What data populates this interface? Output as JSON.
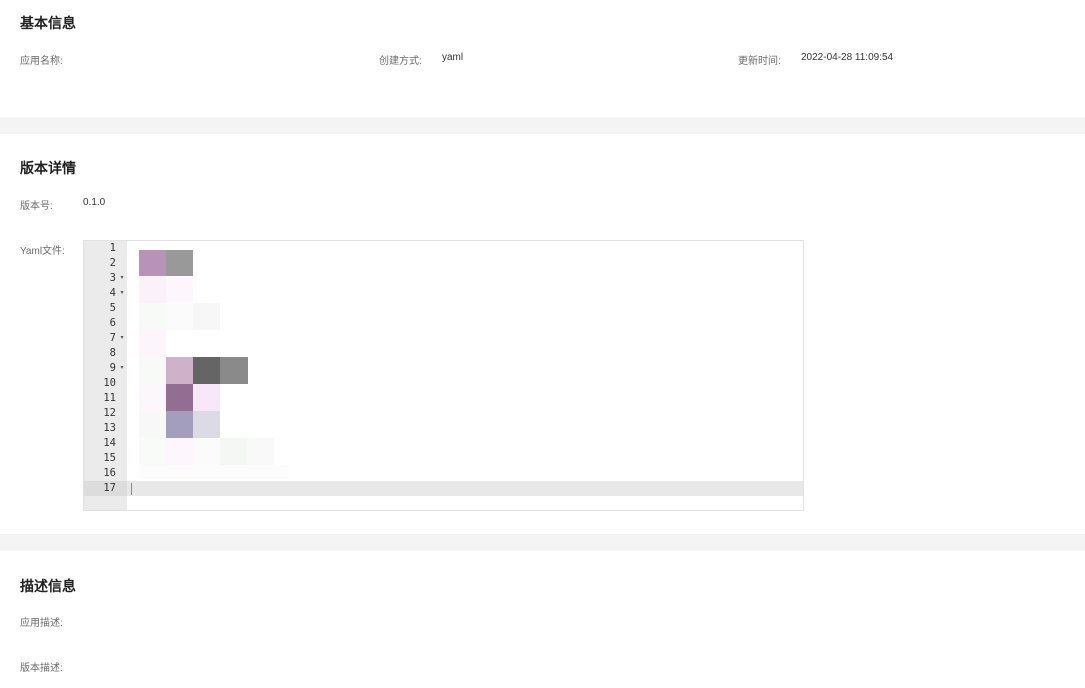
{
  "basic_info": {
    "title": "基本信息",
    "app_name_label": "应用名称:",
    "app_name_value": "",
    "create_method_label": "创建方式:",
    "create_method_value": "yaml",
    "update_time_label": "更新时间:",
    "update_time_value": "2022-04-28 11:09:54"
  },
  "version_details": {
    "title": "版本详情",
    "version_label": "版本号:",
    "version_value": "0.1.0",
    "yaml_label": "Yaml文件:",
    "editor": {
      "lines": [
        "1",
        "2",
        "3",
        "4",
        "5",
        "6",
        "7",
        "8",
        "9",
        "10",
        "11",
        "12",
        "13",
        "14",
        "15",
        "16",
        "17"
      ],
      "fold_lines": [
        3,
        4,
        7,
        9
      ],
      "active_line": 17,
      "fold_glyph": "▾",
      "blurred_colors": [
        "#b992b8",
        "#9a999a",
        "#cfb2c9",
        "#666566",
        "#8b8a8b",
        "#946d92",
        "#a39ebe",
        "#dcdae3",
        "#f6e8f8"
      ]
    }
  },
  "description_info": {
    "title": "描述信息",
    "app_desc_label": "应用描述:",
    "app_desc_value": "",
    "version_desc_label": "版本描述:",
    "version_desc_value": ""
  }
}
